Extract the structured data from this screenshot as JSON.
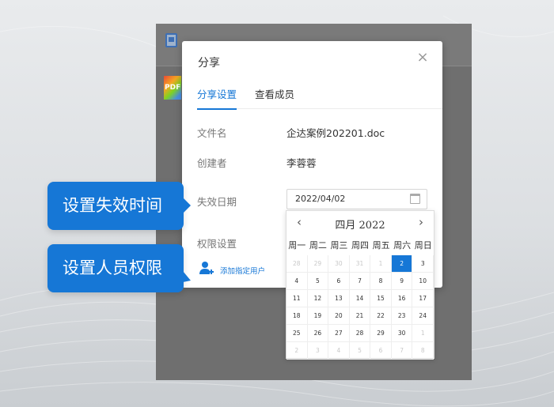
{
  "dialog": {
    "title": "分享",
    "close_icon": "close-icon",
    "tabs": [
      {
        "label": "分享设置",
        "active": true
      },
      {
        "label": "查看成员",
        "active": false
      }
    ],
    "fields": {
      "filename_label": "文件名",
      "filename_value": "企达案例202201.doc",
      "creator_label": "创建者",
      "creator_value": "李蓉蓉",
      "expire_label": "失效日期",
      "expire_value": "2022/04/02",
      "permission_label": "权限设置"
    },
    "add_user_label": "添加指定用户"
  },
  "calendar": {
    "title": "四月 2022",
    "prev_icon": "chevron-left-icon",
    "next_icon": "chevron-right-icon",
    "weekdays": [
      "周一",
      "周二",
      "周三",
      "周四",
      "周五",
      "周六",
      "周日"
    ],
    "days": [
      {
        "d": "28",
        "m": true
      },
      {
        "d": "29",
        "m": true
      },
      {
        "d": "30",
        "m": true
      },
      {
        "d": "31",
        "m": true
      },
      {
        "d": "1",
        "m": true
      },
      {
        "d": "2",
        "s": true
      },
      {
        "d": "3"
      },
      {
        "d": "4"
      },
      {
        "d": "5"
      },
      {
        "d": "6"
      },
      {
        "d": "7"
      },
      {
        "d": "8"
      },
      {
        "d": "9"
      },
      {
        "d": "10"
      },
      {
        "d": "11"
      },
      {
        "d": "12"
      },
      {
        "d": "13"
      },
      {
        "d": "14"
      },
      {
        "d": "15"
      },
      {
        "d": "16"
      },
      {
        "d": "17"
      },
      {
        "d": "18"
      },
      {
        "d": "19"
      },
      {
        "d": "20"
      },
      {
        "d": "21"
      },
      {
        "d": "22"
      },
      {
        "d": "23"
      },
      {
        "d": "24"
      },
      {
        "d": "25"
      },
      {
        "d": "26"
      },
      {
        "d": "27"
      },
      {
        "d": "28"
      },
      {
        "d": "29"
      },
      {
        "d": "30"
      },
      {
        "d": "1",
        "m": true
      },
      {
        "d": "2",
        "m": true
      },
      {
        "d": "3",
        "m": true
      },
      {
        "d": "4",
        "m": true
      },
      {
        "d": "5",
        "m": true
      },
      {
        "d": "6",
        "m": true
      },
      {
        "d": "7",
        "m": true
      },
      {
        "d": "8",
        "m": true
      }
    ]
  },
  "callouts": {
    "expire": "设置失效时间",
    "permission": "设置人员权限"
  },
  "colors": {
    "accent": "#1677d6",
    "overlay": "#6f6f6f"
  }
}
